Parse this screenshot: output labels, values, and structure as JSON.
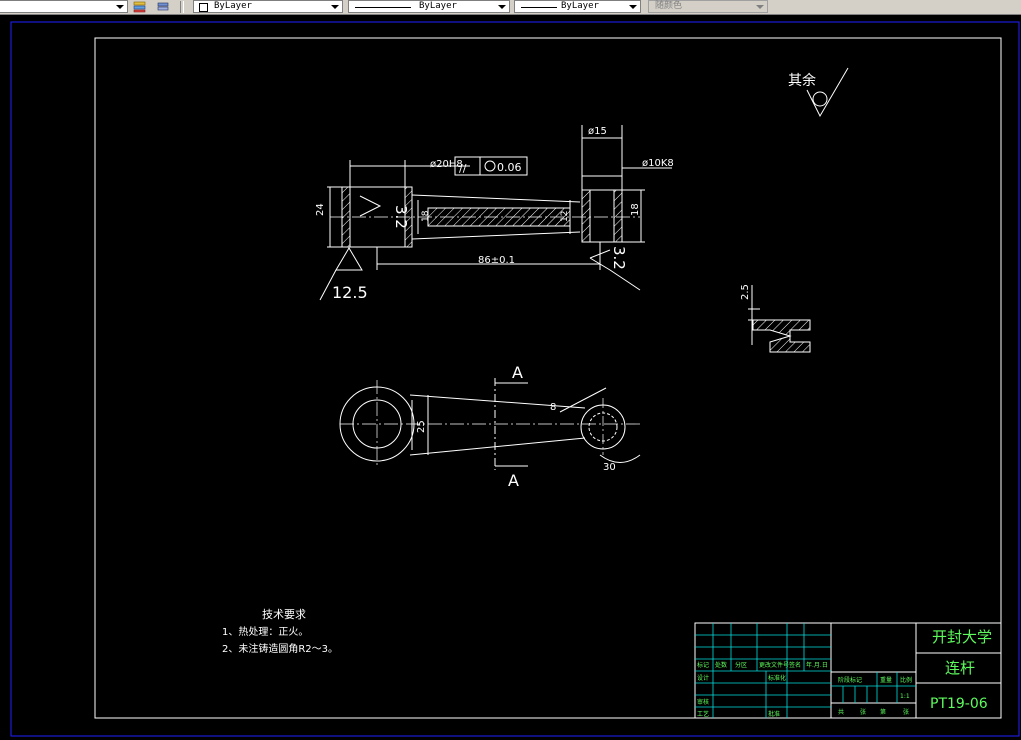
{
  "toolbar": {
    "layer_label": "ByLayer",
    "linetype_label": "ByLayer",
    "lineweight_label": "ByLayer",
    "color_label": "随颜色"
  },
  "drawing": {
    "roughness_other_label": "其余",
    "roughness_12_5": "12.5",
    "roughness_3_2_left": "3.2",
    "roughness_3_2_right": "3.2",
    "dim_phi20": "ø20H8",
    "dim_tol_sym": "//",
    "dim_tol_val": "0.06",
    "dim_phi15": "ø15",
    "dim_phi10": "ø10K8",
    "dim_24": "24",
    "dim_18_right": "18",
    "dim_18_left": "18",
    "dim_12": "12",
    "dim_length": "86±0.1",
    "dim_2_5": "2.5",
    "section_a_top": "A",
    "section_a_bottom": "A",
    "dim_25": "25",
    "dim_r8": "8",
    "dim_30": "30"
  },
  "notes": {
    "title": "技术要求",
    "item1": "1、热处理：正火。",
    "item2": "2、未注铸造圆角R2～3。"
  },
  "title_block": {
    "school": "开封大学",
    "part_name": "连杆",
    "drawing_no": "PT19-06",
    "scale": "1:1",
    "h_mark": "标记",
    "h_count": "处数",
    "h_zone": "分区",
    "h_change": "更改文件号",
    "h_sign": "签名",
    "h_date": "年.月.日",
    "h_design": "设计",
    "h_standard": "标准化",
    "h_review": "审核",
    "h_process": "工艺",
    "h_approve": "批准",
    "h_stage": "阶段标记",
    "h_weight": "重量",
    "h_scale": "比例",
    "h_total": "共",
    "h_sheet": "张",
    "h_of": "第"
  }
}
